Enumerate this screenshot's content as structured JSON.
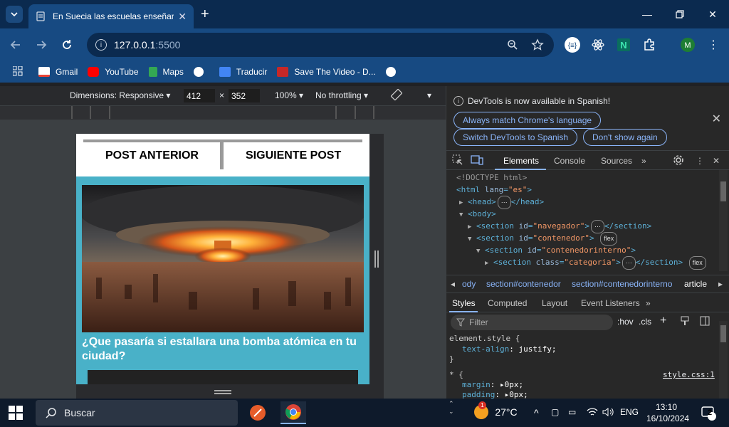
{
  "browser": {
    "tab_title": "En Suecia las escuelas enseñara",
    "url_host": "127.0.0.1",
    "url_port": ":5500"
  },
  "bookmarks": [
    {
      "label": "Gmail",
      "color": "#ea4335"
    },
    {
      "label": "YouTube",
      "color": "#ff0000"
    },
    {
      "label": "Maps",
      "color": "#34a853"
    },
    {
      "label": "",
      "color": "#ffffff"
    },
    {
      "label": "Traducir",
      "color": "#4285f4"
    },
    {
      "label": "Save The Video - D...",
      "color": "#c62828"
    },
    {
      "label": "",
      "color": "#ffffff"
    }
  ],
  "device_toolbar": {
    "dimensions_label": "Dimensions: Responsive",
    "width": "412",
    "times": "×",
    "height": "352",
    "zoom": "100%",
    "throttling": "No throttling"
  },
  "page": {
    "prev_post": "POST ANTERIOR",
    "next_post": "SIGUIENTE POST",
    "article_title": "¿Que pasaría si estallara una bomba atómica en tu ciudad?"
  },
  "devtools": {
    "info_message": "DevTools is now available in Spanish!",
    "btn_always_match": "Always match Chrome's language",
    "btn_switch": "Switch DevTools to Spanish",
    "btn_dont_show": "Don't show again",
    "tabs": [
      "Elements",
      "Console",
      "Sources"
    ],
    "dom": {
      "doctype": "<!DOCTYPE html>",
      "html_open": "<html",
      "html_attr": "lang",
      "html_val": "\"es\"",
      "head": "<head>",
      "head_close": "</head>",
      "body": "<body>",
      "section": "<section",
      "section_close": "</section>",
      "id_attr": "id",
      "class_attr": "class",
      "val_navegador": "\"navegador\"",
      "val_contenedor": "\"contenedor\"",
      "val_contenedorinterno": "\"contenedorinterno\"",
      "val_categoria": "\"categoria\"",
      "badge_flex": "flex",
      "ellipsis": "⋯"
    },
    "breadcrumbs": [
      "ody",
      "section#contenedor",
      "section#contenedorinterno",
      "article"
    ],
    "styles_tabs": [
      "Styles",
      "Computed",
      "Layout",
      "Event Listeners"
    ],
    "filter_placeholder": "Filter",
    "hov": ":hov",
    "cls": ".cls",
    "styles": {
      "element_style": "element.style {",
      "prop1_name": "text-align",
      "prop1_value": "justify;",
      "close_brace": "}",
      "universal": "* {",
      "source_link": "style.css:1",
      "prop2_name": "margin",
      "prop2_value": "0px;",
      "prop3_name": "padding",
      "prop3_value": "0px;"
    }
  },
  "taskbar": {
    "search_placeholder": "Buscar",
    "temperature": "27°C",
    "language": "ENG",
    "time": "13:10",
    "date": "16/10/2024",
    "notification_count": "2",
    "weather_badge": "1"
  }
}
